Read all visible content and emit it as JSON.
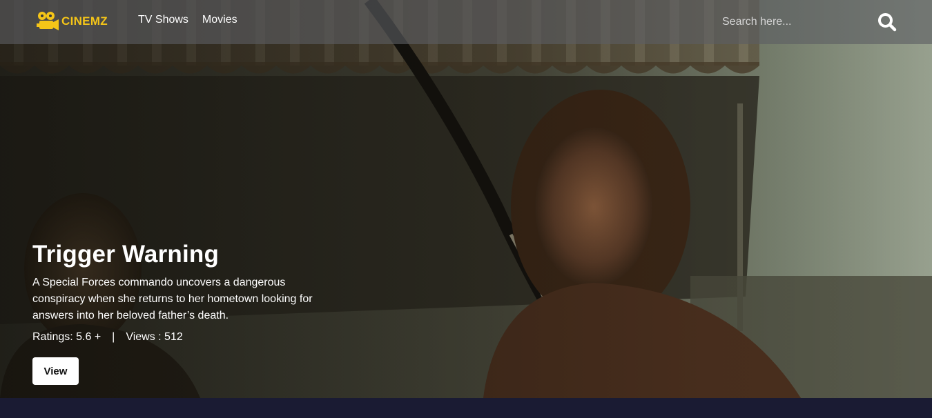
{
  "brand": {
    "name": "CINEMZ",
    "logo_icon": "film-camera-icon",
    "accent_color": "#f5c518"
  },
  "nav": {
    "items": [
      {
        "label": "TV Shows"
      },
      {
        "label": "Movies"
      }
    ]
  },
  "search": {
    "placeholder": "Search here...",
    "value": "",
    "icon": "search-icon"
  },
  "hero": {
    "title": "Trigger Warning",
    "description": "A Special Forces commando uncovers a dangerous conspiracy when she returns to her hometown looking for answers into her beloved father’s death.",
    "ratings": "Ratings: 5.6 +",
    "separator": "|",
    "views": "Views : 512",
    "button_label": "View"
  },
  "colors": {
    "navbar_bg": "#5c5e62",
    "page_bg": "#1a1b33",
    "button_bg": "#ffffff"
  }
}
